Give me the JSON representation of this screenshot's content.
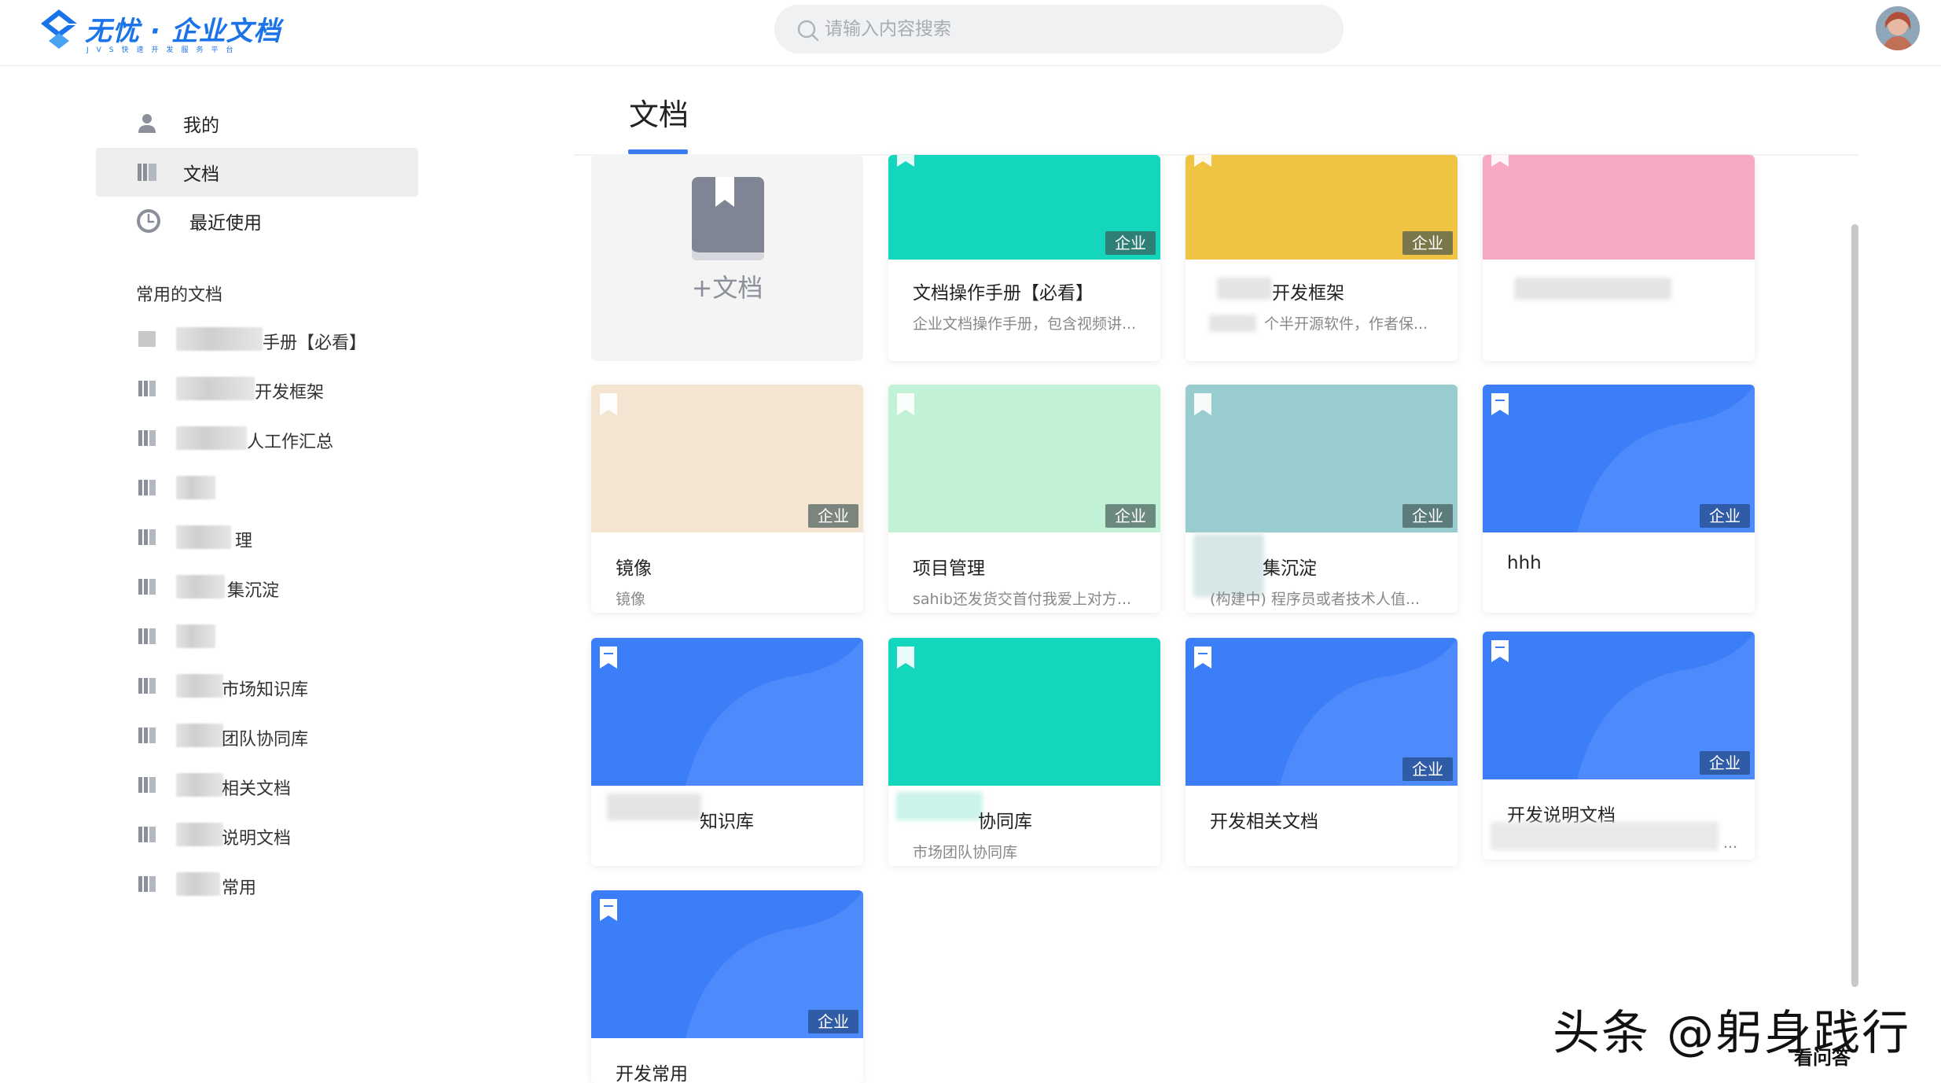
{
  "header": {
    "logo_title": "无忧 · 企业文档",
    "logo_subtitle": "JVS快速开发服务平台",
    "search_placeholder": "请输入内容搜索",
    "brand_color": "#1a73e8"
  },
  "sidebar": {
    "nav": [
      {
        "label": "我的",
        "icon": "user-icon"
      },
      {
        "label": "文档",
        "icon": "library-icon",
        "active": true
      },
      {
        "label": "最近使用",
        "icon": "clock-icon"
      }
    ],
    "section_title": "常用的文档",
    "favorites": [
      {
        "label": "手册【必看】"
      },
      {
        "label": "开发框架"
      },
      {
        "label": "人工作汇总"
      },
      {
        "label": ""
      },
      {
        "label": "理"
      },
      {
        "label": "集沉淀"
      },
      {
        "label": ""
      },
      {
        "label": "市场知识库"
      },
      {
        "label": "团队协同库"
      },
      {
        "label": "相关文档"
      },
      {
        "label": "说明文档"
      },
      {
        "label": "常用"
      }
    ]
  },
  "main": {
    "title": "文档",
    "new_doc_label": "+文档",
    "badge_label": "企业",
    "accent_color": "#3b7cf2",
    "cards": [
      {
        "title": "文档操作手册【必看】",
        "desc": "企业文档操作手册，包含视频讲...",
        "color": "#14d6bc"
      },
      {
        "title": "开发框架",
        "desc": "个半开源软件，作者保...",
        "color": "#eec442"
      },
      {
        "title": "",
        "desc": "",
        "color": "#f7a8c4"
      },
      {
        "title": "镜像",
        "desc": "镜像",
        "color": "#f4e5d3"
      },
      {
        "title": "项目管理",
        "desc": "sahib还发货交首付我爱上对方...",
        "color": "#c2f2d5"
      },
      {
        "title": "集沉淀",
        "desc": "(构建中) 程序员或者技术人值...",
        "color": "#98cccf"
      },
      {
        "title": "hhh",
        "desc": "",
        "color": "#3c7ef8"
      },
      {
        "title": "知识库",
        "desc": "",
        "color": "#3c7ef8"
      },
      {
        "title": "协同库",
        "desc": "市场团队协同库",
        "color": "#14d6bc"
      },
      {
        "title": "开发相关文档",
        "desc": "",
        "color": "#3c7ef8"
      },
      {
        "title": "开发说明文档",
        "desc": "...",
        "color": "#3c7ef8"
      },
      {
        "title": "开发常用",
        "desc": "",
        "color": "#3c7ef8"
      }
    ]
  },
  "watermark": {
    "text": "头条 @躬身践行",
    "site": "看问答"
  }
}
